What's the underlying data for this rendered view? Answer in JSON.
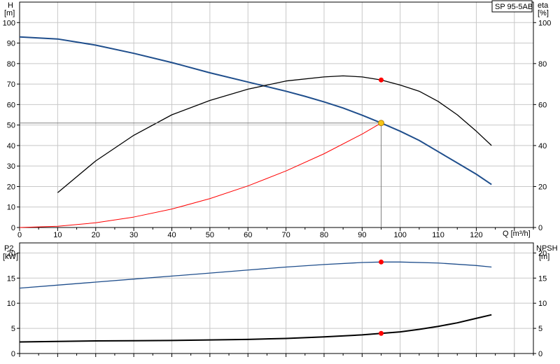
{
  "model_label": "SP 95-5AB",
  "colors": {
    "head": "#1f4e8c",
    "eta": "#000000",
    "system": "#ff0000",
    "p2": "#1f4e8c",
    "npsh": "#000000",
    "duty_marker": "#ff0000",
    "duty_marker_main": "#f5c518",
    "grid": "#c8c8c8",
    "guide": "#808080"
  },
  "chart_data": [
    {
      "type": "line",
      "name": "top",
      "x_axis": {
        "label": "Q [m³/h]",
        "range": [
          0,
          135
        ],
        "ticks": [
          0,
          10,
          20,
          30,
          40,
          50,
          60,
          70,
          80,
          90,
          100,
          110,
          120
        ]
      },
      "y_left": {
        "label_line1": "H",
        "label_line2": "[m]",
        "range": [
          0,
          110
        ],
        "ticks": [
          0,
          10,
          20,
          30,
          40,
          50,
          60,
          70,
          80,
          90,
          100
        ]
      },
      "y_right": {
        "label_line1": "eta",
        "label_line2": "[%]",
        "range": [
          0,
          110
        ],
        "ticks": [
          0,
          20,
          40,
          60,
          80,
          100
        ]
      },
      "grid": true,
      "series": [
        {
          "key": "head",
          "axis": "left",
          "x": [
            0,
            10,
            20,
            30,
            40,
            50,
            60,
            70,
            75,
            80,
            85,
            90,
            95,
            100,
            105,
            110,
            115,
            120,
            124
          ],
          "y": [
            93,
            92,
            89,
            85,
            80.5,
            75.5,
            71,
            66.5,
            64,
            61.3,
            58.3,
            54.8,
            51,
            47,
            42.5,
            37,
            31.5,
            26,
            21
          ]
        },
        {
          "key": "eta",
          "axis": "right",
          "x": [
            10,
            20,
            30,
            40,
            50,
            60,
            70,
            80,
            85,
            90,
            95,
            100,
            105,
            110,
            115,
            120,
            124
          ],
          "y": [
            17,
            32.5,
            45,
            55,
            62,
            67.5,
            71.5,
            73.5,
            74,
            73.5,
            72,
            69.5,
            66.5,
            61.5,
            55,
            47,
            40
          ]
        },
        {
          "key": "system",
          "axis": "left",
          "x": [
            0,
            10,
            20,
            30,
            40,
            50,
            60,
            70,
            80,
            90,
            95
          ],
          "y": [
            0,
            0.6,
            2.3,
            5.1,
            9,
            14.1,
            20.3,
            27.6,
            36,
            45.6,
            51
          ]
        }
      ],
      "duty_point": {
        "q": 95,
        "h": 51,
        "eta": 72
      }
    },
    {
      "type": "line",
      "name": "bottom",
      "x_axis": {
        "range": [
          0,
          135
        ],
        "ticks": [
          0,
          10,
          20,
          30,
          40,
          50,
          60,
          70,
          80,
          90,
          100,
          110,
          120
        ]
      },
      "y_left": {
        "label_line1": "P2",
        "label_line2": "[kW]",
        "range": [
          0,
          22
        ],
        "ticks": [
          0,
          5,
          10,
          15,
          20
        ]
      },
      "y_right": {
        "label_line1": "NPSH",
        "label_line2": "[m]",
        "range": [
          0,
          22
        ],
        "ticks": [
          0,
          5,
          10,
          15,
          20
        ]
      },
      "grid": true,
      "series": [
        {
          "key": "p2",
          "axis": "left",
          "x": [
            0,
            10,
            20,
            30,
            40,
            50,
            60,
            70,
            80,
            90,
            95,
            100,
            110,
            120,
            124
          ],
          "y": [
            13,
            13.6,
            14.2,
            14.8,
            15.4,
            16,
            16.6,
            17.2,
            17.7,
            18.1,
            18.2,
            18.2,
            18,
            17.5,
            17.2
          ]
        },
        {
          "key": "npsh",
          "axis": "right",
          "x": [
            0,
            10,
            20,
            30,
            40,
            50,
            60,
            70,
            80,
            90,
            95,
            100,
            105,
            110,
            115,
            120,
            124
          ],
          "y": [
            2.3,
            2.4,
            2.5,
            2.55,
            2.6,
            2.7,
            2.8,
            3,
            3.3,
            3.7,
            4,
            4.3,
            4.8,
            5.4,
            6.1,
            7,
            7.7
          ]
        }
      ],
      "duty_point": {
        "q": 95,
        "p2": 18.2,
        "npsh": 4
      }
    }
  ]
}
